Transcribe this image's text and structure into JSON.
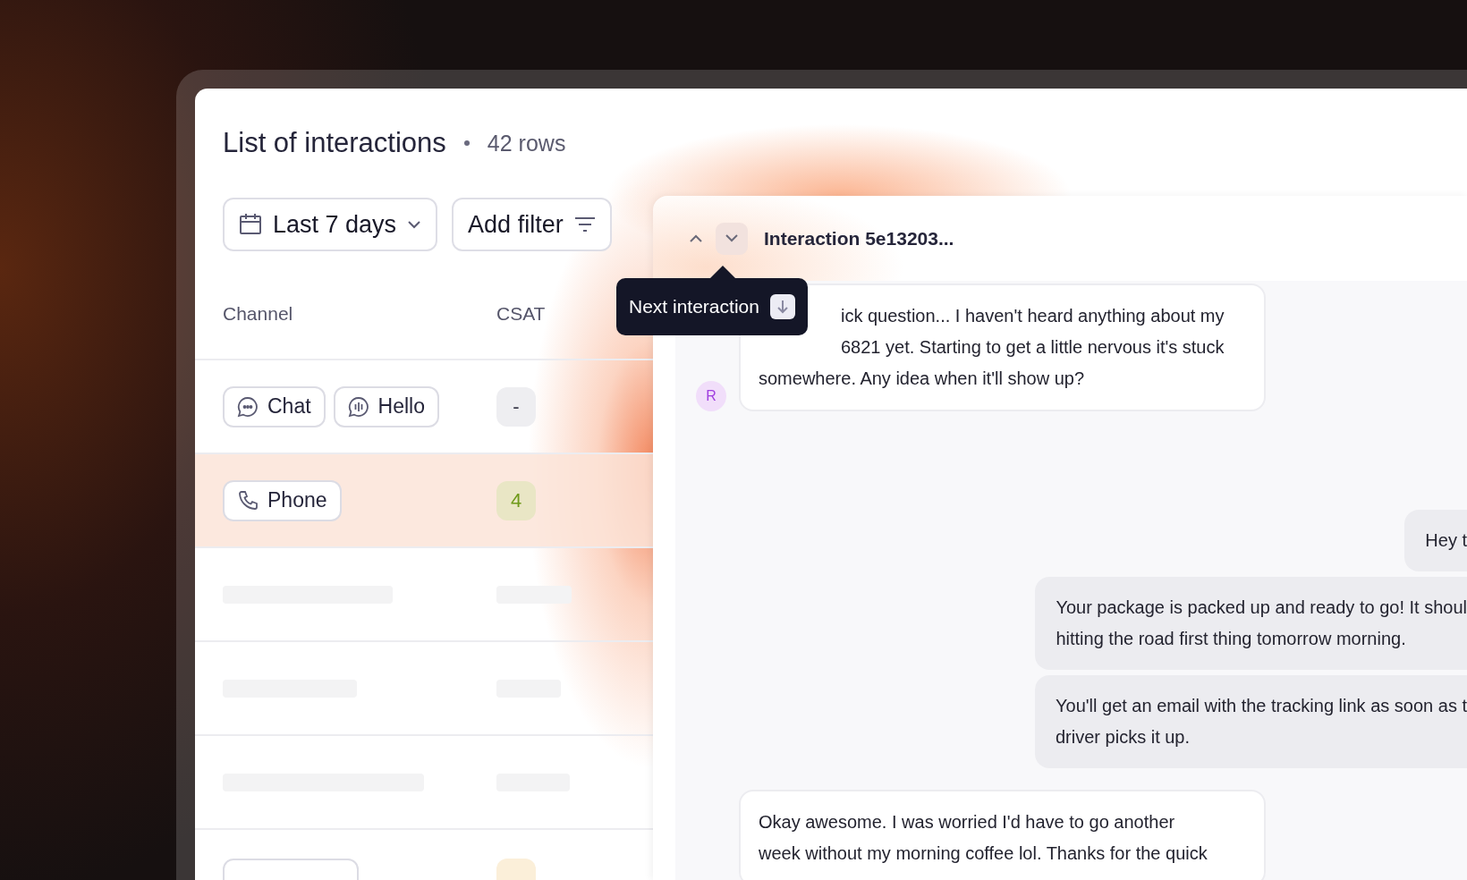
{
  "list": {
    "title": "List of interactions",
    "count": "42 rows"
  },
  "filters": [
    {
      "kind": "date",
      "label": "Last 7 days"
    },
    {
      "kind": "filter",
      "label": "Add filter"
    }
  ],
  "table": {
    "columns": [
      "Channel",
      "CSAT"
    ],
    "rows": [
      {
        "kind": "data",
        "selected": false,
        "channels": [
          {
            "kind": "chat",
            "label": "Chat"
          },
          {
            "kind": "voice",
            "label": "Hello"
          }
        ],
        "csat": {
          "kind": "empty",
          "text": "-",
          "color": "#eeeef1"
        }
      },
      {
        "kind": "data",
        "selected": true,
        "channels": [
          {
            "kind": "phone",
            "label": "Phone"
          }
        ],
        "csat": {
          "kind": "score",
          "text": "4",
          "color": "#e9e6c5"
        }
      },
      {
        "kind": "loading",
        "selected": false
      },
      {
        "kind": "loading",
        "selected": false
      },
      {
        "kind": "loading",
        "selected": false
      },
      {
        "kind": "cut",
        "selected": false,
        "csat": {
          "color": "#fbefd9"
        }
      }
    ]
  },
  "interaction": {
    "title": "Interaction 5e13203...",
    "nav": [
      {
        "kind": "up",
        "highlighted": false
      },
      {
        "kind": "down",
        "highlighted": true
      }
    ],
    "tooltip": {
      "label": "Next interaction"
    },
    "messages": [
      {
        "kind": "customer",
        "avatar": "R",
        "lines": [
          "ick question... I haven't heard anything about my",
          "6821 yet. Starting to get a little nervous it's stuck",
          "somewhere. Any idea when it'll show up?"
        ]
      },
      {
        "kind": "agent",
        "lines": [
          "Hey t"
        ]
      },
      {
        "kind": "agent",
        "lines": [
          "Your package is packed up and ready to go! It shoul",
          "hitting the road first thing tomorrow morning."
        ]
      },
      {
        "kind": "agent",
        "lines": [
          "You'll get an email with the tracking link as soon as t",
          "driver picks it up."
        ]
      },
      {
        "kind": "customer",
        "lines": [
          "Okay awesome. I was worried I'd have to go another",
          "week without my morning coffee lol. Thanks for the quick"
        ]
      }
    ]
  }
}
